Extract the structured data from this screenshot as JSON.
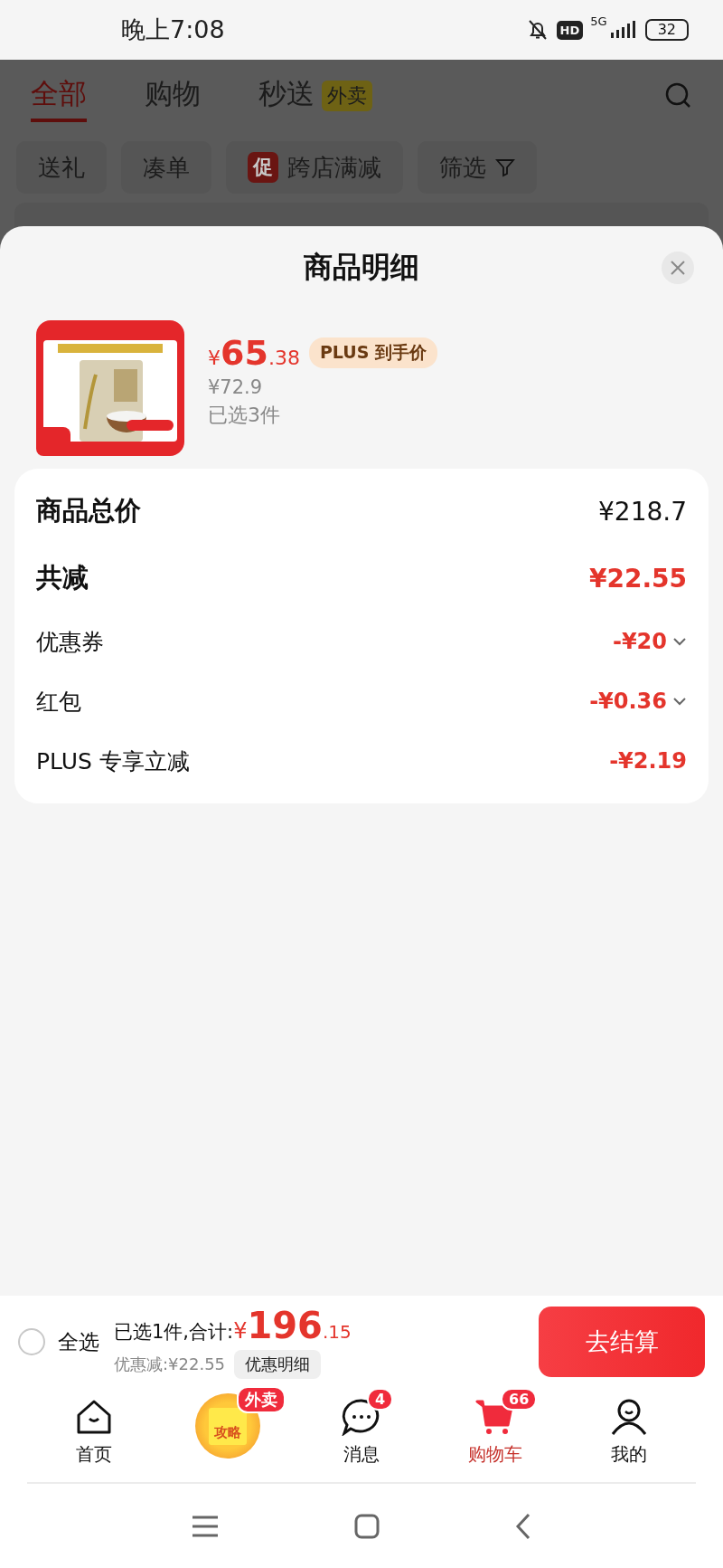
{
  "status_bar": {
    "time": "晚上7:08",
    "hd_label": "HD",
    "network": "5G",
    "battery": "32"
  },
  "top_tabs": [
    {
      "label": "全部",
      "selected": true
    },
    {
      "label": "购物",
      "selected": false
    },
    {
      "label": "秒送",
      "selected": false,
      "badge": "外卖"
    }
  ],
  "filter_chips": [
    {
      "label": "送礼",
      "kind": "plain"
    },
    {
      "label": "凑单",
      "kind": "plain"
    },
    {
      "label": "跨店满减",
      "kind": "promo",
      "tag": "促"
    },
    {
      "label": "筛选",
      "kind": "filter"
    }
  ],
  "sheet": {
    "title": "商品明细",
    "product": {
      "price_symbol": "¥",
      "price_int": "65",
      "price_dec": ".38",
      "price_label": "PLUS 到手价",
      "original_price": "¥72.9",
      "quantity": "已选3件"
    },
    "summary": [
      {
        "label": "商品总价",
        "value": "¥218.7",
        "kind": "total",
        "expandable": false
      },
      {
        "label": "共减",
        "value": "¥22.55",
        "kind": "discount_total",
        "expandable": false
      },
      {
        "label": "优惠券",
        "value": "-¥20",
        "kind": "discount",
        "expandable": true
      },
      {
        "label": "红包",
        "value": "-¥0.36",
        "kind": "discount",
        "expandable": true
      },
      {
        "label": "PLUS 专享立减",
        "value": "-¥2.19",
        "kind": "discount",
        "expandable": false
      }
    ]
  },
  "cart_bar": {
    "select_all": {
      "label": "全选",
      "checked": false
    },
    "summary": "已选1件,合计:",
    "total_symbol": "¥",
    "total_int": "196",
    "total_dec": ".15",
    "saving": "优惠减:¥22.55",
    "detail_button": "优惠明细",
    "checkout_button": "去结算"
  },
  "bottom_nav": [
    {
      "kind": "home",
      "label": "首页",
      "selected": false
    },
    {
      "kind": "promo",
      "promo_text": "攻略",
      "badge": "外卖",
      "selected": false
    },
    {
      "kind": "message",
      "label": "消息",
      "badge": "4",
      "selected": false
    },
    {
      "kind": "cart",
      "label": "购物车",
      "badge": "66",
      "selected": true
    },
    {
      "kind": "profile",
      "label": "我的",
      "selected": false
    }
  ]
}
